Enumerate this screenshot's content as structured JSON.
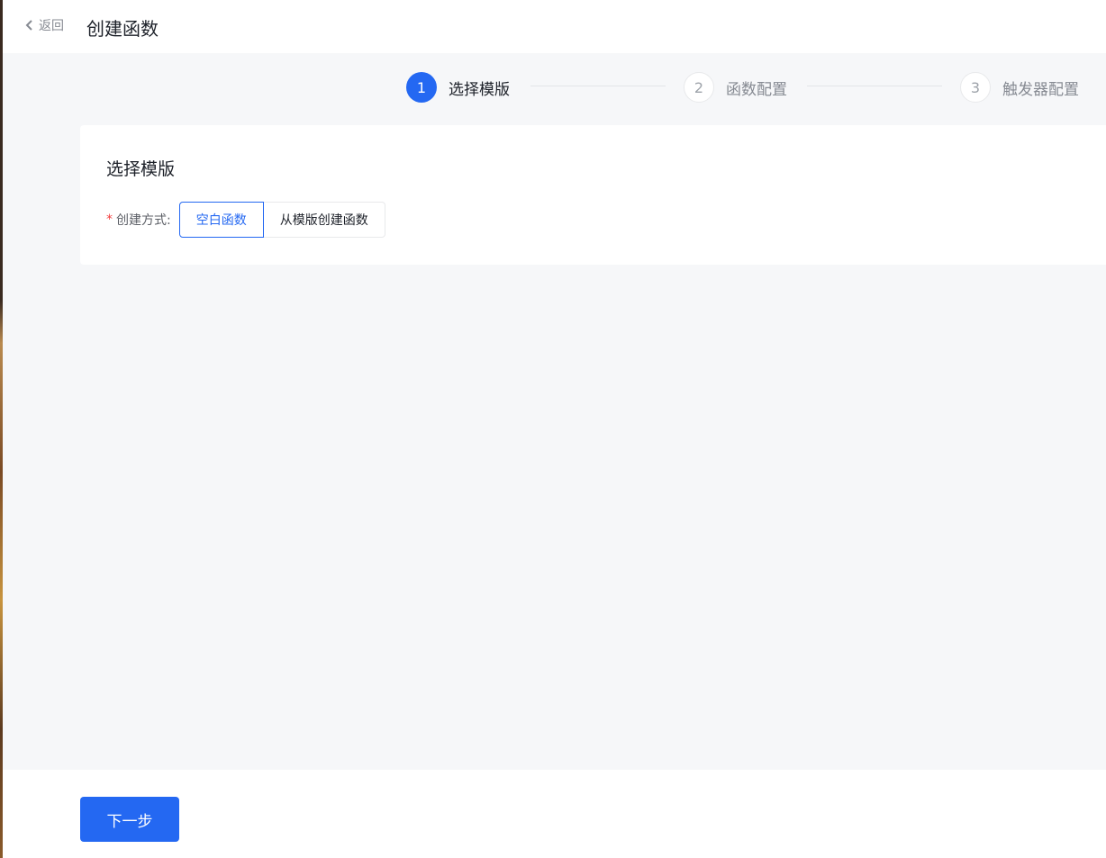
{
  "header": {
    "back_label": "返回",
    "title": "创建函数"
  },
  "steps": [
    {
      "number": "1",
      "label": "选择模版",
      "status": "active"
    },
    {
      "number": "2",
      "label": "函数配置",
      "status": "pending"
    },
    {
      "number": "3",
      "label": "触发器配置",
      "status": "pending"
    }
  ],
  "card": {
    "title": "选择模版",
    "field": {
      "required_mark": "*",
      "label": "创建方式:",
      "options": [
        "空白函数",
        "从模版创建函数"
      ],
      "selected": "空白函数"
    }
  },
  "footer": {
    "next_label": "下一步"
  },
  "colors": {
    "primary": "#2468f2",
    "background": "#f6f7f9",
    "required": "#f33e3e"
  }
}
